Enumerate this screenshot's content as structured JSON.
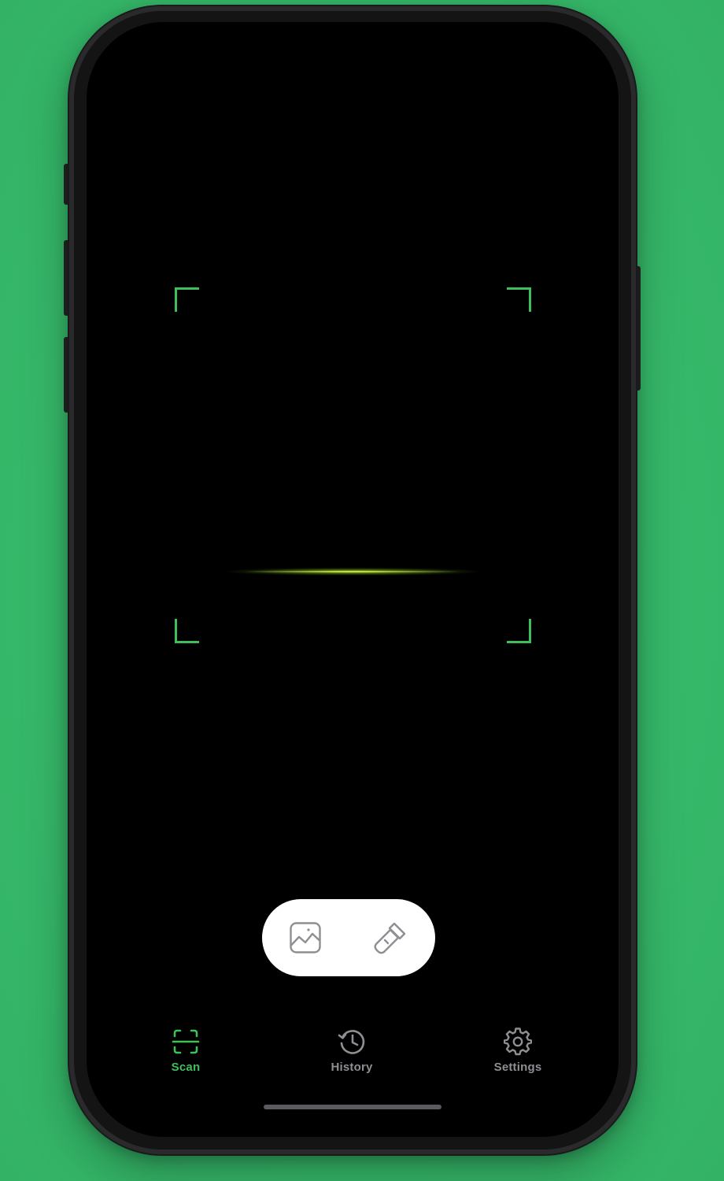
{
  "app": {
    "screen": "scanner"
  },
  "colors": {
    "accent": "#3fbf5a",
    "background": "#38b86b",
    "inactive": "#8e8e93"
  },
  "scanner": {
    "frame_icon": "viewfinder-corners",
    "scan_line_icon": "laser-line"
  },
  "actions": {
    "gallery_icon": "photo-icon",
    "flashlight_icon": "flashlight-icon"
  },
  "tabbar": {
    "tabs": [
      {
        "label": "Scan",
        "icon": "scan-icon",
        "active": true
      },
      {
        "label": "History",
        "icon": "history-icon",
        "active": false
      },
      {
        "label": "Settings",
        "icon": "gear-icon",
        "active": false
      }
    ]
  }
}
